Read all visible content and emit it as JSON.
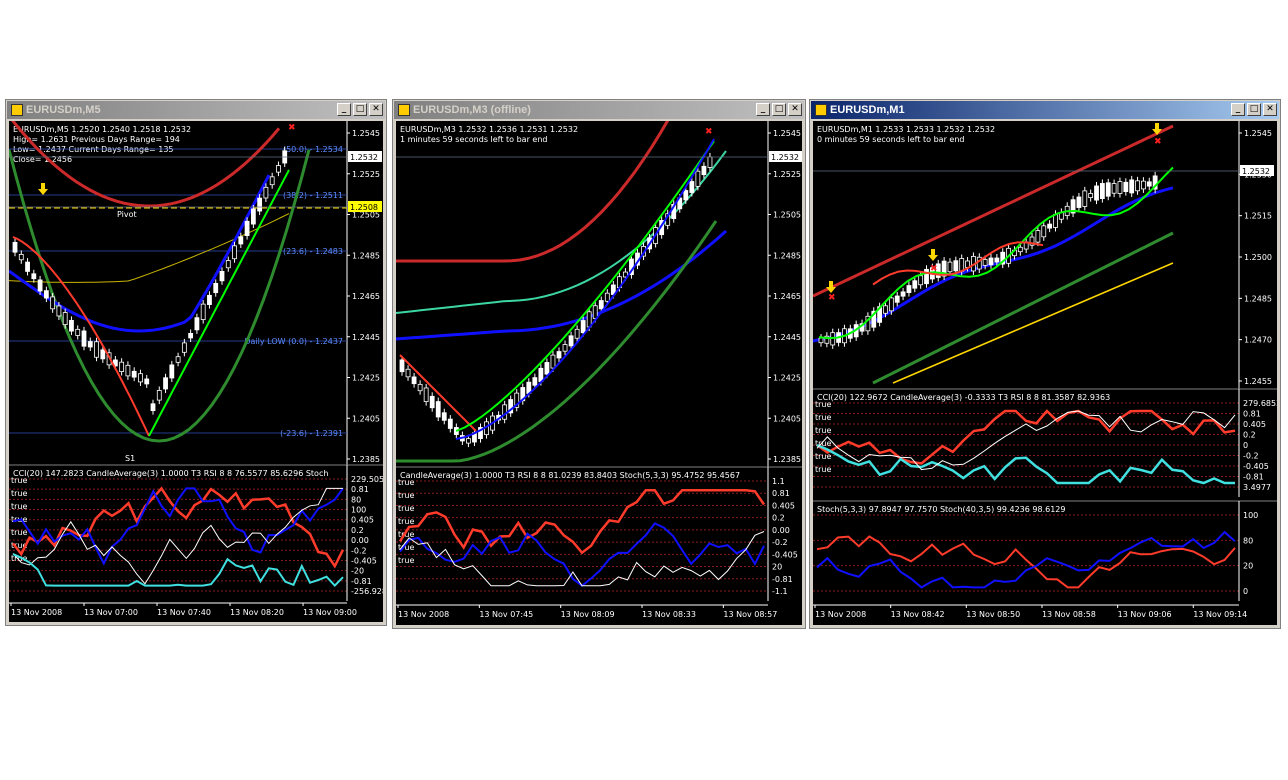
{
  "windows": [
    {
      "title": "EURUSDm,M5",
      "active": false,
      "info_lines": [
        "EURUSDm,M5  1.2520 1.2540 1.2518 1.2532",
        "High= 1.2631     Previous Days Range= 194",
        "Low= 1.2437     Current Days Range= 135",
        "Close= 1.2456"
      ],
      "price_labels": [
        "1.2545",
        "1.2525",
        "1.2505",
        "1.2485",
        "1.2465",
        "1.2445",
        "1.2425",
        "1.2405",
        "1.2385"
      ],
      "current_price": "1.2532",
      "pivot_price": "1.2508",
      "fib_labels": [
        "(50.0) - 1.2534",
        "(38.2) - 1.2511",
        "(23.6) - 1.2483",
        "Daily LOW (0.0) - 1.2437",
        "(-23.6) - 1.2391"
      ],
      "pivot_label": "Pivot",
      "s1_label": "S1",
      "indicator1_title": "CCI(20) 147.2823  CandleAverage(3) 1.0000  T3 RSI 8 8 76.5577 85.6296  Stoch",
      "indicator1_scale": [
        "229.5052",
        "0.81",
        "80",
        "100",
        "0.405",
        "0.2",
        "0.00",
        "-0.2",
        "-0.405",
        "-20",
        "-0.81",
        "-256.928"
      ],
      "true_labels": [
        "true",
        "true",
        "true",
        "true",
        "true",
        "true",
        "true"
      ],
      "time_labels": [
        "13 Nov 2008",
        "13 Nov 07:00",
        "13 Nov 07:40",
        "13 Nov 08:20",
        "13 Nov 09:00"
      ]
    },
    {
      "title": "EURUSDm,M3 (offline)",
      "active": false,
      "info_lines": [
        "EURUSDm,M3  1.2532 1.2536 1.2531 1.2532",
        "1 minutes 59 seconds left to bar end"
      ],
      "price_labels": [
        "1.2545",
        "1.2525",
        "1.2505",
        "1.2485",
        "1.2465",
        "1.2445",
        "1.2425",
        "1.2405",
        "1.2385"
      ],
      "current_price": "1.2532",
      "indicator1_title": "CandleAverage(3) 1.0000  T3 RSI 8 8 81.0239 83.8403  Stoch(5,3,3) 95.4752 95.4567",
      "indicator1_scale": [
        "1.1",
        "0.81",
        "0.405",
        "0.2",
        "0.00",
        "-0.2",
        "-0.405",
        "20",
        "-0.81",
        "-1.1"
      ],
      "true_labels": [
        "true",
        "true",
        "true",
        "true",
        "true",
        "true",
        "true"
      ],
      "time_labels": [
        "13 Nov 2008",
        "13 Nov 07:45",
        "13 Nov 08:09",
        "13 Nov 08:33",
        "13 Nov 08:57"
      ]
    },
    {
      "title": "EURUSDm,M1",
      "active": true,
      "info_lines": [
        "EURUSDm,M1  1.2533 1.2533 1.2532 1.2532",
        "0 minutes 59 seconds left to bar end"
      ],
      "price_labels": [
        "1.2545",
        "1.2530",
        "1.2515",
        "1.2500",
        "1.2485",
        "1.2470",
        "1.2455"
      ],
      "current_price": "1.2532",
      "indicator1_title": "CCI(20) 122.9672  CandleAverage(3) -0.3333  T3 RSI 8 8 81.3587 82.9363",
      "indicator1_scale": [
        "279.6852",
        "0.81",
        "0.405",
        "0.2",
        "0",
        "-0.2",
        "-0.405",
        "-0.81",
        "3.4977"
      ],
      "indicator2_title": "Stoch(5,3,3) 97.8947 97.7570  Stoch(40,3,5) 99.4236 98.6129",
      "indicator2_scale": [
        "100",
        "80",
        "20",
        "0"
      ],
      "true_labels": [
        "true",
        "true",
        "true",
        "true",
        "true",
        "true"
      ],
      "time_labels": [
        "13 Nov 2008",
        "13 Nov 08:42",
        "13 Nov 08:50",
        "13 Nov 08:58",
        "13 Nov 09:06",
        "13 Nov 09:14"
      ]
    }
  ],
  "colors": {
    "ma_red": "#cc2a2a",
    "ma_green": "#2e8b2e",
    "ma_teal": "#3cd6a0",
    "blue": "#1010ff",
    "fast_green": "#00ff00",
    "fast_red": "#ff3b2b",
    "cyan": "#40e0e0",
    "yellow": "#ffd700"
  },
  "icons": [
    "minimize-icon",
    "maximize-icon",
    "close-icon",
    "window-icon"
  ],
  "caption_buttons": {
    "minimize": "_",
    "maximize": "□",
    "close": "✕"
  }
}
